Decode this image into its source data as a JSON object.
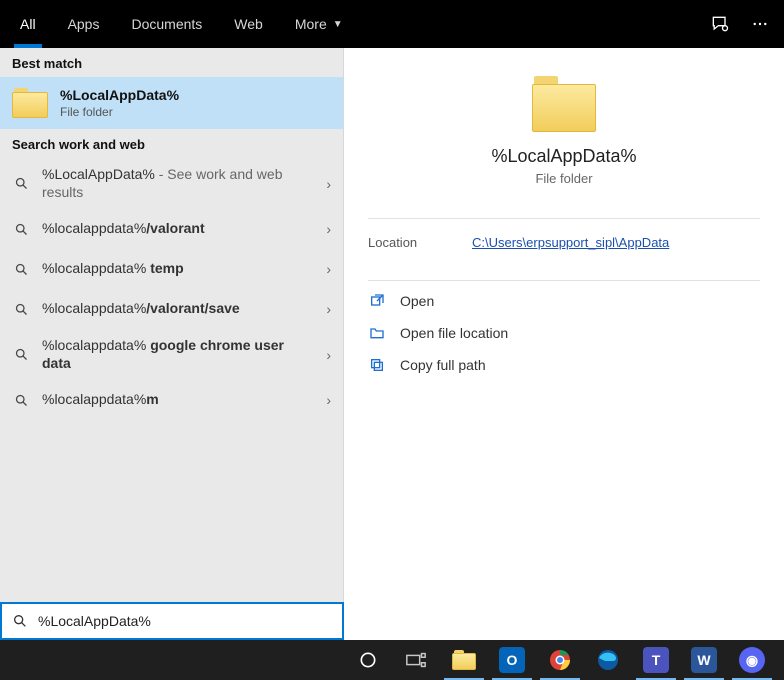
{
  "tabs": {
    "all": "All",
    "apps": "Apps",
    "documents": "Documents",
    "web": "Web",
    "more": "More"
  },
  "left": {
    "best_match_label": "Best match",
    "best_match": {
      "title": "%LocalAppData%",
      "subtitle": "File folder"
    },
    "search_section_label": "Search work and web",
    "suggestions": [
      {
        "prefix": "%LocalAppData%",
        "bold": "",
        "suffix": " - See work and web results"
      },
      {
        "prefix": "%localappdata%",
        "bold": "/valorant",
        "suffix": ""
      },
      {
        "prefix": "%localappdata% ",
        "bold": "temp",
        "suffix": ""
      },
      {
        "prefix": "%localappdata%",
        "bold": "/valorant/save",
        "suffix": ""
      },
      {
        "prefix": "%localappdata% ",
        "bold": "google chrome user data",
        "suffix": ""
      },
      {
        "prefix": "%localappdata%",
        "bold": "m",
        "suffix": ""
      }
    ]
  },
  "right": {
    "title": "%LocalAppData%",
    "subtitle": "File folder",
    "location_label": "Location",
    "location_value": "C:\\Users\\erpsupport_sipl\\AppData",
    "actions": {
      "open": "Open",
      "openloc": "Open file location",
      "copy": "Copy full path"
    }
  },
  "search": {
    "value": "%LocalAppData%"
  }
}
